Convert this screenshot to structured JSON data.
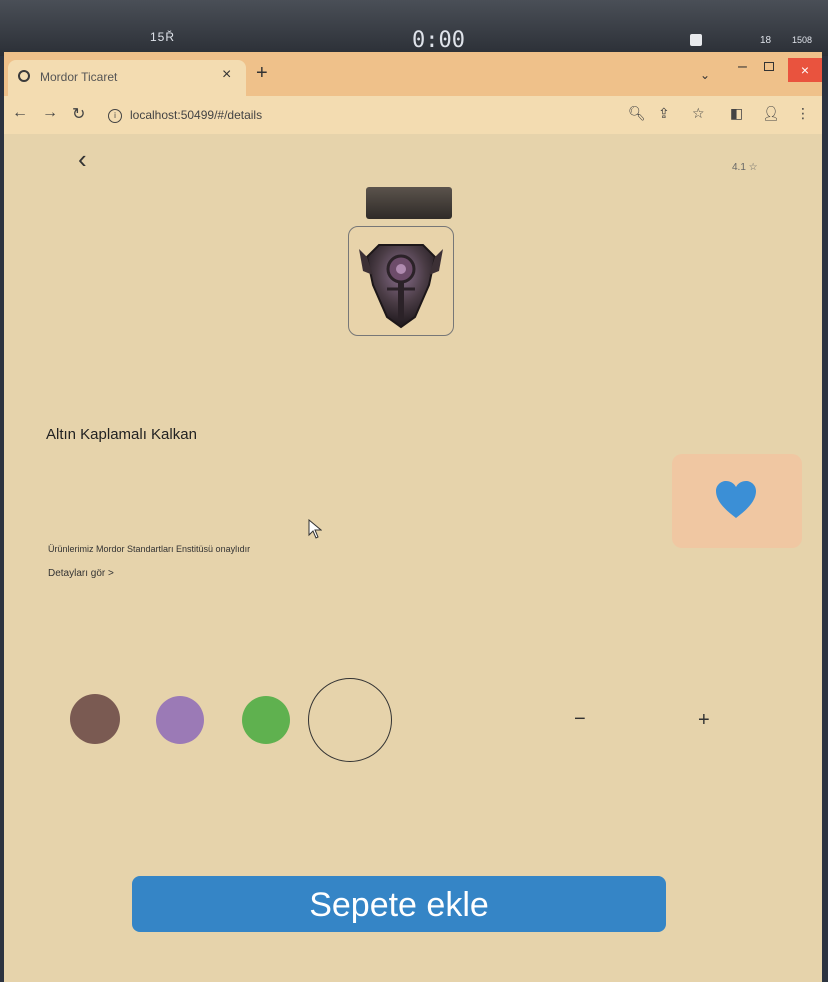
{
  "os_taskbar": {
    "left_status": "15Ř",
    "clock": "0:00",
    "tray_number": "18",
    "tray_right": "1508"
  },
  "browser": {
    "tab": {
      "title": "Mordor Ticaret"
    },
    "new_tab_label": "+",
    "window_close_label": "×",
    "address": "localhost:50499/#/details"
  },
  "page": {
    "back_label": "‹",
    "rating_text": "4.1 ☆",
    "product_name": "Altın Kaplamalı Kalkan",
    "notice_text": "Ürünlerimiz Mordor Standartları Enstitüsü onaylıdır",
    "details_link": "Detayları gör  >",
    "colors": [
      "#7a5a52",
      "#9b7ab6",
      "#5fb14f",
      "transparent"
    ],
    "favorite_color": "#3b8fd6",
    "quantity_minus": "−",
    "quantity_plus": "+",
    "add_to_cart_label": "Sepete ekle",
    "accent_color": "#3585c6"
  }
}
